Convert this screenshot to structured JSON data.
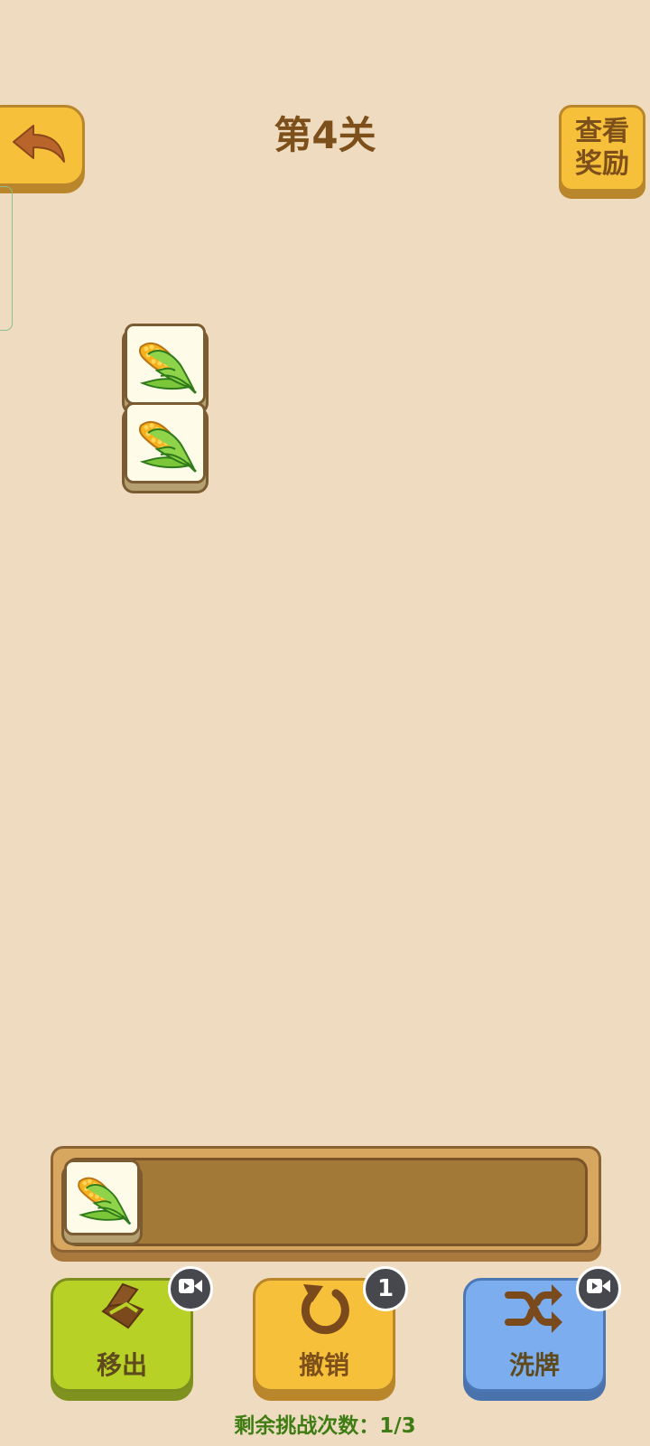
{
  "header": {
    "back_icon": "back-arrow-icon",
    "title": "第4关",
    "reward_line1": "查看",
    "reward_line2": "奖励"
  },
  "board": {
    "tiles": [
      {
        "icon": "corn-icon"
      },
      {
        "icon": "corn-icon"
      }
    ]
  },
  "slot": {
    "tiles": [
      {
        "icon": "corn-icon"
      }
    ]
  },
  "actions": {
    "remove": {
      "label": "移出",
      "icon": "box-out-icon",
      "badge_icon": "video-camera-icon"
    },
    "undo": {
      "label": "撤销",
      "icon": "undo-icon",
      "badge": "1"
    },
    "shuffle": {
      "label": "洗牌",
      "icon": "shuffle-icon",
      "badge_icon": "video-camera-icon"
    }
  },
  "footer": {
    "remaining_text": "剩余挑战次数：1/3"
  },
  "colors": {
    "background": "#efdcc0",
    "yellow_button": "#f6c03a",
    "green_button": "#b8d126",
    "blue_button": "#7caeef",
    "title_brown": "#7d4f1b",
    "footer_green": "#3f7d14"
  }
}
